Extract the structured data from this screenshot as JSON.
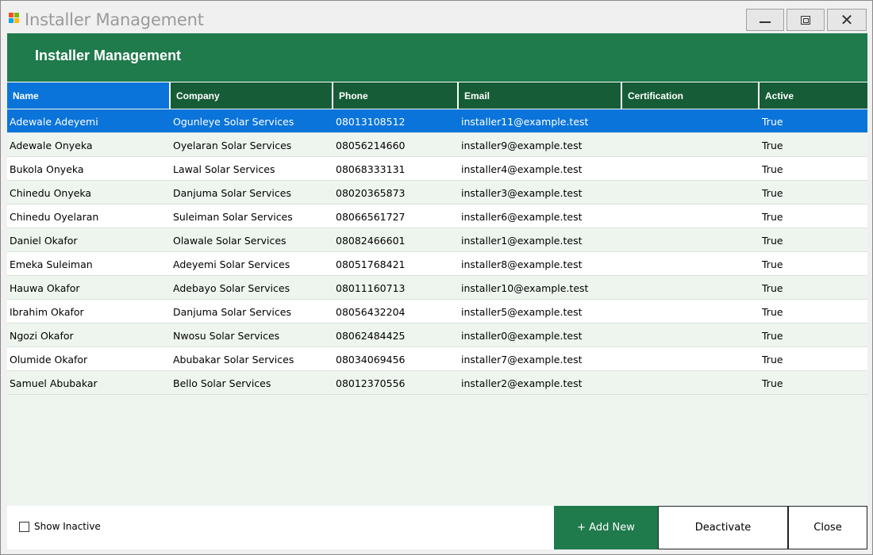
{
  "window": {
    "title": "Installer Management",
    "controls": {
      "minimize": "minimize",
      "maximize": "maximize",
      "close": "close"
    }
  },
  "header": {
    "title": "Installer Management"
  },
  "colors": {
    "header_bg": "#1f7a4c",
    "grid_header_bg": "#165c37",
    "selection": "#0a74da",
    "alt_row": "#eef5ef"
  },
  "grid": {
    "columns": [
      "Name",
      "Company",
      "Phone",
      "Email",
      "Certification",
      "Active"
    ],
    "selected_row": 0,
    "rows": [
      {
        "name": "Adewale Adeyemi",
        "company": "Ogunleye Solar Services",
        "phone": "08013108512",
        "email": "installer11@example.test",
        "certification": "",
        "active": "True"
      },
      {
        "name": "Adewale Onyeka",
        "company": "Oyelaran Solar Services",
        "phone": "08056214660",
        "email": "installer9@example.test",
        "certification": "",
        "active": "True"
      },
      {
        "name": "Bukola Onyeka",
        "company": "Lawal Solar Services",
        "phone": "08068333131",
        "email": "installer4@example.test",
        "certification": "",
        "active": "True"
      },
      {
        "name": "Chinedu Onyeka",
        "company": "Danjuma Solar Services",
        "phone": "08020365873",
        "email": "installer3@example.test",
        "certification": "",
        "active": "True"
      },
      {
        "name": "Chinedu Oyelaran",
        "company": "Suleiman Solar Services",
        "phone": "08066561727",
        "email": "installer6@example.test",
        "certification": "",
        "active": "True"
      },
      {
        "name": "Daniel Okafor",
        "company": "Olawale Solar Services",
        "phone": "08082466601",
        "email": "installer1@example.test",
        "certification": "",
        "active": "True"
      },
      {
        "name": "Emeka Suleiman",
        "company": "Adeyemi Solar Services",
        "phone": "08051768421",
        "email": "installer8@example.test",
        "certification": "",
        "active": "True"
      },
      {
        "name": "Hauwa Okafor",
        "company": "Adebayo Solar Services",
        "phone": "08011160713",
        "email": "installer10@example.test",
        "certification": "",
        "active": "True"
      },
      {
        "name": "Ibrahim Okafor",
        "company": "Danjuma Solar Services",
        "phone": "08056432204",
        "email": "installer5@example.test",
        "certification": "",
        "active": "True"
      },
      {
        "name": "Ngozi Okafor",
        "company": "Nwosu Solar Services",
        "phone": "08062484425",
        "email": "installer0@example.test",
        "certification": "",
        "active": "True"
      },
      {
        "name": "Olumide Okafor",
        "company": "Abubakar Solar Services",
        "phone": "08034069456",
        "email": "installer7@example.test",
        "certification": "",
        "active": "True"
      },
      {
        "name": "Samuel Abubakar",
        "company": "Bello Solar Services",
        "phone": "08012370556",
        "email": "installer2@example.test",
        "certification": "",
        "active": "True"
      }
    ]
  },
  "footer": {
    "show_inactive_label": "Show Inactive",
    "show_inactive_checked": false,
    "add_new_label": "+ Add New",
    "deactivate_label": "Deactivate",
    "close_label": "Close"
  }
}
